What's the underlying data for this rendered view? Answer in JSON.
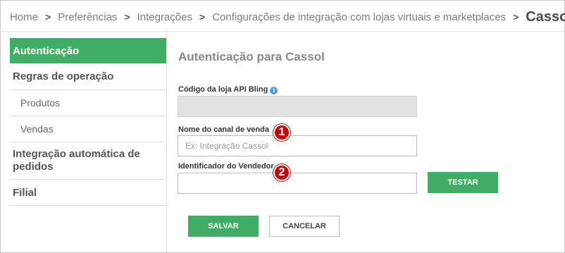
{
  "breadcrumb": {
    "items": [
      "Home",
      "Preferências",
      "Integrações",
      "Configurações de integração com lojas virtuais e marketplaces"
    ],
    "current": "Cassol",
    "separator": ">"
  },
  "sidebar": {
    "items": [
      {
        "label": "Autenticação",
        "active": true
      },
      {
        "label": "Regras de operação"
      },
      {
        "label": "Produtos"
      },
      {
        "label": "Vendas"
      },
      {
        "label": "Integração automática de pedidos"
      },
      {
        "label": "Filial"
      }
    ]
  },
  "main": {
    "title": "Autenticação para Cassol",
    "fields": {
      "store_code": {
        "label": "Código da loja API Bling",
        "value": "",
        "info_icon": "info-icon"
      },
      "channel_name": {
        "label": "Nome do canal de venda",
        "placeholder": "Ex: Integração Cassol",
        "value": ""
      },
      "seller_id": {
        "label": "Identificador do Vendedor",
        "value": ""
      }
    },
    "badges": {
      "one": "1",
      "two": "2"
    },
    "buttons": {
      "test": "TESTAR",
      "save": "SALVAR",
      "cancel": "CANCELAR"
    }
  },
  "colors": {
    "accent": "#3fad66",
    "badge": "#c00a0a",
    "info": "#5b9bd5"
  }
}
